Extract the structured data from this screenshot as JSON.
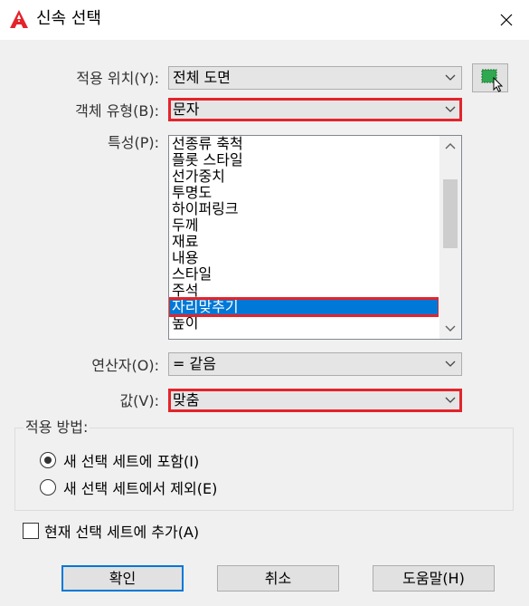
{
  "window": {
    "title": "신속 선택",
    "logo_icon": "autocad-logo-icon",
    "close_icon": "close-icon"
  },
  "fields": {
    "apply_to_label": "적용 위치(Y):",
    "apply_to_value": "전체 도면",
    "object_type_label": "객체 유형(B):",
    "object_type_value": "문자",
    "properties_label": "특성(P):",
    "operator_label": "연산자(O):",
    "operator_value": "= 같음",
    "value_label": "값(V):",
    "value_value": "맞춤"
  },
  "properties": [
    "선종류 축척",
    "플롯 스타일",
    "선가중치",
    "투명도",
    "하이퍼링크",
    "두께",
    "재료",
    "내용",
    "스타일",
    "주석",
    "자리맞추기",
    "높이"
  ],
  "selected_property": "자리맞추기",
  "how_to_apply": {
    "title": "적용 방법:",
    "options": [
      {
        "label": "새 선택 세트에 포함(I)",
        "selected": true
      },
      {
        "label": "새 선택 세트에서 제외(E)",
        "selected": false
      }
    ]
  },
  "append": {
    "label": "현재 선택 세트에 추가(A)",
    "checked": false
  },
  "buttons": {
    "ok": "확인",
    "cancel": "취소",
    "help": "도움말(H)"
  },
  "colors": {
    "highlight": "#e3242b",
    "selection": "#0078d7",
    "logo": "#e3242b",
    "pick_icon": "#2fa84f"
  }
}
